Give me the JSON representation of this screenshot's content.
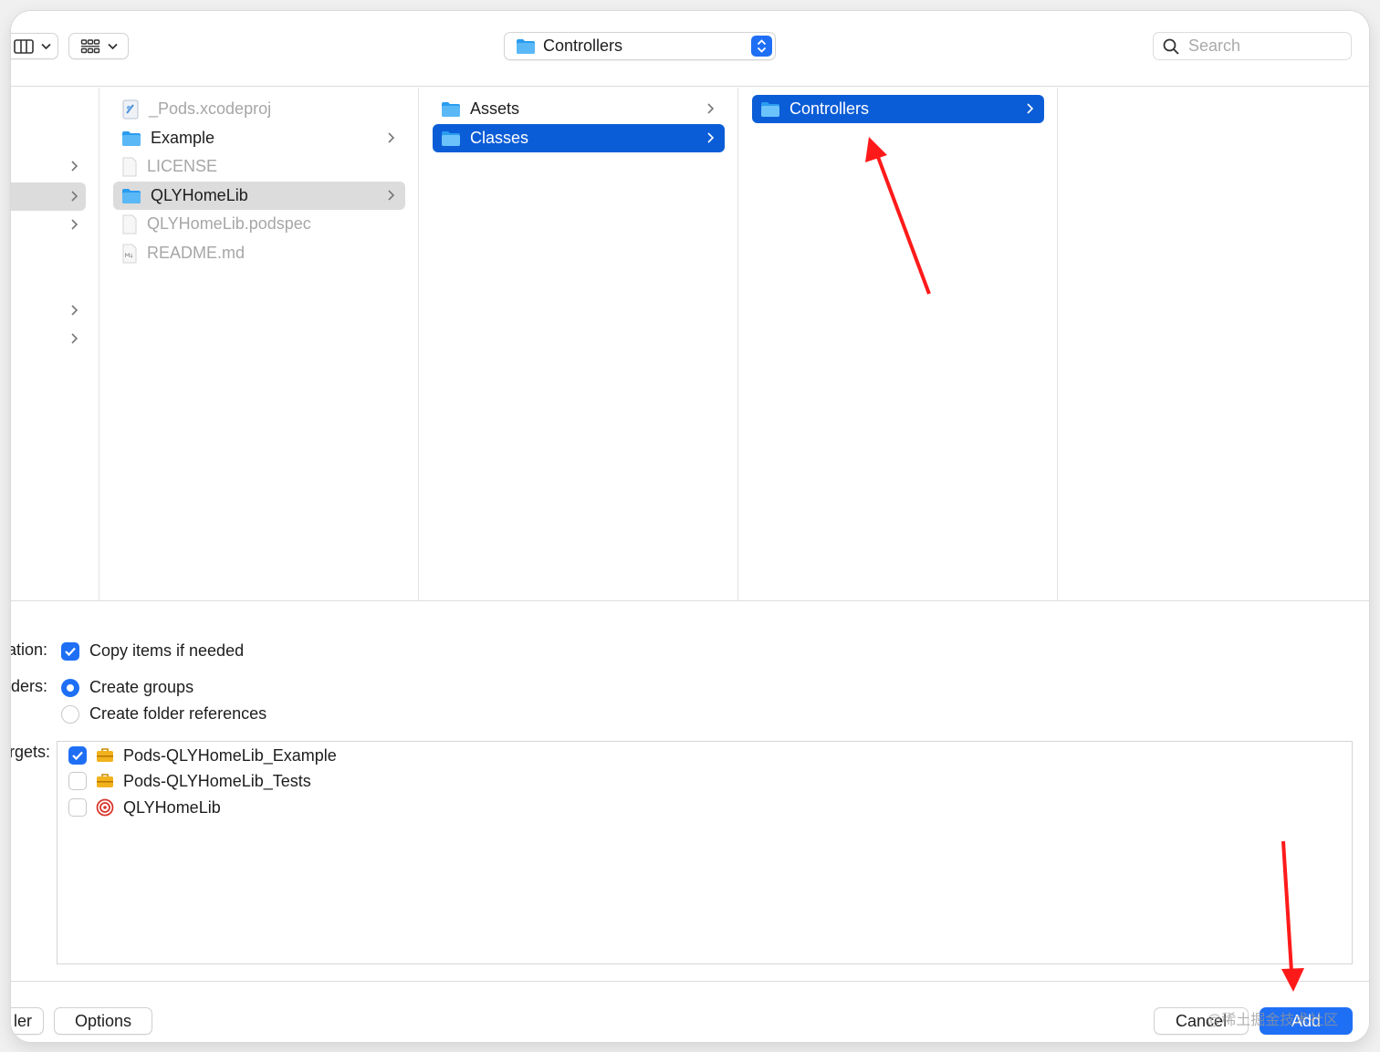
{
  "toolbar": {
    "location_popup": {
      "label": "Controllers"
    },
    "search": {
      "placeholder": "Search"
    }
  },
  "browser": {
    "column1": [
      {
        "label": "_Pods.xcodeproj",
        "icon": "xcodeproj-icon",
        "dimmed": true
      },
      {
        "label": "Example",
        "icon": "folder-icon"
      },
      {
        "label": "LICENSE",
        "icon": "document-icon",
        "dimmed": true
      },
      {
        "label": "QLYHomeLib",
        "icon": "folder-icon",
        "selected": "inactive"
      },
      {
        "label": "QLYHomeLib.podspec",
        "icon": "document-icon",
        "dimmed": true
      },
      {
        "label": "README.md",
        "icon": "markdown-icon",
        "dimmed": true
      }
    ],
    "column2": [
      {
        "label": "Assets",
        "icon": "folder-icon"
      },
      {
        "label": "Classes",
        "icon": "folder-icon",
        "selected": "active"
      }
    ],
    "column3": [
      {
        "label": "Controllers",
        "icon": "folder-icon",
        "selected": "active"
      }
    ]
  },
  "options": {
    "destination_label": "ation:",
    "copy_items": {
      "label": "Copy items if needed",
      "checked": true
    },
    "folders_label": "ders:",
    "create_groups": {
      "label": "Create groups",
      "selected": true
    },
    "create_folder_refs": {
      "label": "Create folder references",
      "selected": false
    },
    "targets_label": "rgets:",
    "targets": [
      {
        "label": "Pods-QLYHomeLib_Example",
        "checked": true,
        "icon": "toolbox-icon"
      },
      {
        "label": "Pods-QLYHomeLib_Tests",
        "checked": false,
        "icon": "toolbox-icon"
      },
      {
        "label": "QLYHomeLib",
        "checked": false,
        "icon": "target-icon"
      }
    ]
  },
  "footer": {
    "new_folder_label": "ler",
    "options_label": "Options",
    "cancel_label": "Cancel",
    "add_label": "Add",
    "watermark": "@稀土掘金技术社区"
  },
  "colors": {
    "accent": "#1f6ff5",
    "selection": "#0b5dd7",
    "annotation_arrow": "#ff1a1a"
  }
}
